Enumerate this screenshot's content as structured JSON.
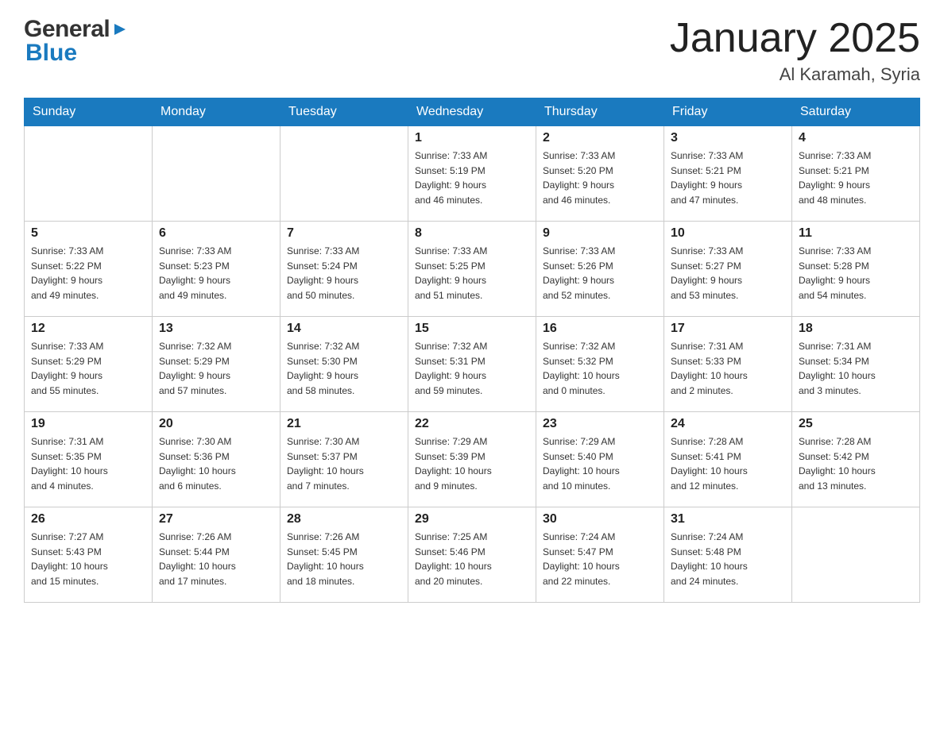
{
  "header": {
    "title": "January 2025",
    "location": "Al Karamah, Syria"
  },
  "logo": {
    "general": "General",
    "blue": "Blue"
  },
  "days": [
    "Sunday",
    "Monday",
    "Tuesday",
    "Wednesday",
    "Thursday",
    "Friday",
    "Saturday"
  ],
  "weeks": [
    [
      {
        "day": "",
        "info": ""
      },
      {
        "day": "",
        "info": ""
      },
      {
        "day": "",
        "info": ""
      },
      {
        "day": "1",
        "info": "Sunrise: 7:33 AM\nSunset: 5:19 PM\nDaylight: 9 hours\nand 46 minutes."
      },
      {
        "day": "2",
        "info": "Sunrise: 7:33 AM\nSunset: 5:20 PM\nDaylight: 9 hours\nand 46 minutes."
      },
      {
        "day": "3",
        "info": "Sunrise: 7:33 AM\nSunset: 5:21 PM\nDaylight: 9 hours\nand 47 minutes."
      },
      {
        "day": "4",
        "info": "Sunrise: 7:33 AM\nSunset: 5:21 PM\nDaylight: 9 hours\nand 48 minutes."
      }
    ],
    [
      {
        "day": "5",
        "info": "Sunrise: 7:33 AM\nSunset: 5:22 PM\nDaylight: 9 hours\nand 49 minutes."
      },
      {
        "day": "6",
        "info": "Sunrise: 7:33 AM\nSunset: 5:23 PM\nDaylight: 9 hours\nand 49 minutes."
      },
      {
        "day": "7",
        "info": "Sunrise: 7:33 AM\nSunset: 5:24 PM\nDaylight: 9 hours\nand 50 minutes."
      },
      {
        "day": "8",
        "info": "Sunrise: 7:33 AM\nSunset: 5:25 PM\nDaylight: 9 hours\nand 51 minutes."
      },
      {
        "day": "9",
        "info": "Sunrise: 7:33 AM\nSunset: 5:26 PM\nDaylight: 9 hours\nand 52 minutes."
      },
      {
        "day": "10",
        "info": "Sunrise: 7:33 AM\nSunset: 5:27 PM\nDaylight: 9 hours\nand 53 minutes."
      },
      {
        "day": "11",
        "info": "Sunrise: 7:33 AM\nSunset: 5:28 PM\nDaylight: 9 hours\nand 54 minutes."
      }
    ],
    [
      {
        "day": "12",
        "info": "Sunrise: 7:33 AM\nSunset: 5:29 PM\nDaylight: 9 hours\nand 55 minutes."
      },
      {
        "day": "13",
        "info": "Sunrise: 7:32 AM\nSunset: 5:29 PM\nDaylight: 9 hours\nand 57 minutes."
      },
      {
        "day": "14",
        "info": "Sunrise: 7:32 AM\nSunset: 5:30 PM\nDaylight: 9 hours\nand 58 minutes."
      },
      {
        "day": "15",
        "info": "Sunrise: 7:32 AM\nSunset: 5:31 PM\nDaylight: 9 hours\nand 59 minutes."
      },
      {
        "day": "16",
        "info": "Sunrise: 7:32 AM\nSunset: 5:32 PM\nDaylight: 10 hours\nand 0 minutes."
      },
      {
        "day": "17",
        "info": "Sunrise: 7:31 AM\nSunset: 5:33 PM\nDaylight: 10 hours\nand 2 minutes."
      },
      {
        "day": "18",
        "info": "Sunrise: 7:31 AM\nSunset: 5:34 PM\nDaylight: 10 hours\nand 3 minutes."
      }
    ],
    [
      {
        "day": "19",
        "info": "Sunrise: 7:31 AM\nSunset: 5:35 PM\nDaylight: 10 hours\nand 4 minutes."
      },
      {
        "day": "20",
        "info": "Sunrise: 7:30 AM\nSunset: 5:36 PM\nDaylight: 10 hours\nand 6 minutes."
      },
      {
        "day": "21",
        "info": "Sunrise: 7:30 AM\nSunset: 5:37 PM\nDaylight: 10 hours\nand 7 minutes."
      },
      {
        "day": "22",
        "info": "Sunrise: 7:29 AM\nSunset: 5:39 PM\nDaylight: 10 hours\nand 9 minutes."
      },
      {
        "day": "23",
        "info": "Sunrise: 7:29 AM\nSunset: 5:40 PM\nDaylight: 10 hours\nand 10 minutes."
      },
      {
        "day": "24",
        "info": "Sunrise: 7:28 AM\nSunset: 5:41 PM\nDaylight: 10 hours\nand 12 minutes."
      },
      {
        "day": "25",
        "info": "Sunrise: 7:28 AM\nSunset: 5:42 PM\nDaylight: 10 hours\nand 13 minutes."
      }
    ],
    [
      {
        "day": "26",
        "info": "Sunrise: 7:27 AM\nSunset: 5:43 PM\nDaylight: 10 hours\nand 15 minutes."
      },
      {
        "day": "27",
        "info": "Sunrise: 7:26 AM\nSunset: 5:44 PM\nDaylight: 10 hours\nand 17 minutes."
      },
      {
        "day": "28",
        "info": "Sunrise: 7:26 AM\nSunset: 5:45 PM\nDaylight: 10 hours\nand 18 minutes."
      },
      {
        "day": "29",
        "info": "Sunrise: 7:25 AM\nSunset: 5:46 PM\nDaylight: 10 hours\nand 20 minutes."
      },
      {
        "day": "30",
        "info": "Sunrise: 7:24 AM\nSunset: 5:47 PM\nDaylight: 10 hours\nand 22 minutes."
      },
      {
        "day": "31",
        "info": "Sunrise: 7:24 AM\nSunset: 5:48 PM\nDaylight: 10 hours\nand 24 minutes."
      },
      {
        "day": "",
        "info": ""
      }
    ]
  ]
}
